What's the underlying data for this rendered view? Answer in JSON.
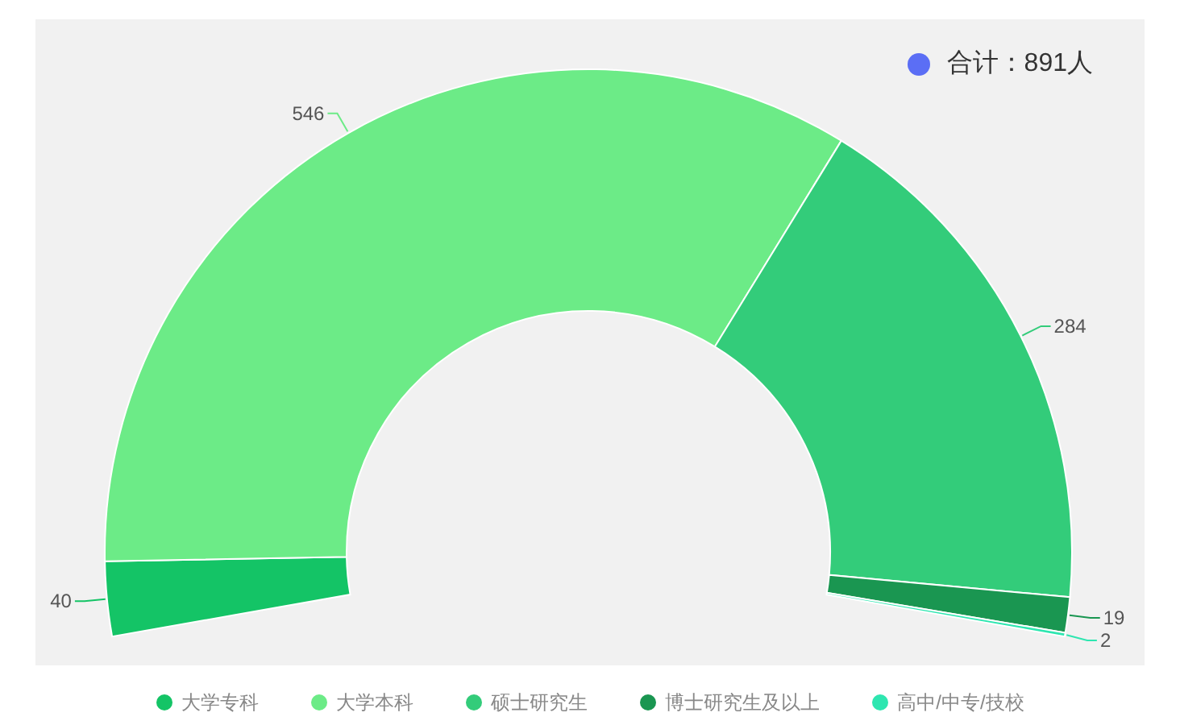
{
  "total": {
    "label": "合计：891人",
    "color": "#5b6ef5"
  },
  "chart_data": {
    "type": "donut",
    "categories": [
      "大学专科",
      "大学本科",
      "硕士研究生",
      "博士研究生及以上",
      "高中/中专/技校"
    ],
    "values": [
      40,
      546,
      284,
      19,
      2
    ],
    "data_labels": true
  },
  "legend": [
    {
      "color": "#14c466"
    },
    {
      "color": "#6ceb87"
    },
    {
      "color": "#33cc7a"
    },
    {
      "color": "#1a9651"
    },
    {
      "color": "#2ee6b0"
    }
  ]
}
